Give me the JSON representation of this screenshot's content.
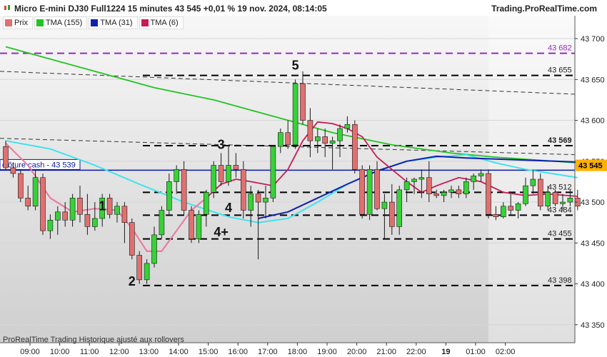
{
  "header": {
    "title": "Micro E-mini DJ30 Full1224 15 minutes 43 545 +0,01 % 19 nov. 2024, 08:14:05",
    "brand": "Trading.ProRealTime.com"
  },
  "legend": [
    {
      "label": "Prix",
      "color": "#e07070"
    },
    {
      "label": "TMA (155)",
      "color": "#22c422"
    },
    {
      "label": "TMA (31)",
      "color": "#1020b0"
    },
    {
      "label": "TMA (6)",
      "color": "#c81a55"
    }
  ],
  "footer": "ProRealTime Trading  Historique ajusté aux rollovers",
  "chart_data": {
    "type": "candlestick",
    "ylim": [
      43328,
      43728
    ],
    "y_ticks": [
      43350,
      43400,
      43450,
      43500,
      43550,
      43600,
      43650,
      43700
    ],
    "y_tick_labels": [
      "43 350",
      "43 400",
      "43 450",
      "43 500",
      "43 550",
      "43 600",
      "43 650",
      "43 700"
    ],
    "x_labels": [
      "09:00",
      "10:00",
      "11:00",
      "12:00",
      "13:00",
      "14:00",
      "15:00",
      "16:00",
      "17:00",
      "18:00",
      "19:00",
      "20:00",
      "21:00",
      "22:00",
      "19",
      "01:00",
      "02:00"
    ],
    "x_label_positions": [
      0,
      4,
      8,
      12,
      16,
      20,
      24,
      28,
      32,
      36,
      40,
      44,
      48,
      52,
      56,
      60,
      64
    ],
    "candles": [
      [
        43568,
        43575,
        43540,
        43542
      ],
      [
        43542,
        43548,
        43530,
        43535
      ],
      [
        43535,
        43540,
        43500,
        43505
      ],
      [
        43505,
        43520,
        43490,
        43495
      ],
      [
        43495,
        43540,
        43490,
        43530
      ],
      [
        43530,
        43535,
        43460,
        43465
      ],
      [
        43465,
        43485,
        43455,
        43478
      ],
      [
        43478,
        43495,
        43460,
        43488
      ],
      [
        43488,
        43500,
        43470,
        43478
      ],
      [
        43478,
        43510,
        43470,
        43505
      ],
      [
        43505,
        43520,
        43475,
        43485
      ],
      [
        43485,
        43510,
        43460,
        43470
      ],
      [
        43470,
        43500,
        43465,
        43480
      ],
      [
        43480,
        43510,
        43470,
        43505
      ],
      [
        43505,
        43510,
        43480,
        43485
      ],
      [
        43485,
        43500,
        43475,
        43495
      ],
      [
        43495,
        43500,
        43450,
        43475
      ],
      [
        43475,
        43480,
        43430,
        43435
      ],
      [
        43435,
        43440,
        43400,
        43405
      ],
      [
        43405,
        43430,
        43400,
        43425
      ],
      [
        43425,
        43470,
        43420,
        43460
      ],
      [
        43460,
        43495,
        43455,
        43490
      ],
      [
        43490,
        43535,
        43485,
        43525
      ],
      [
        43525,
        43545,
        43510,
        43540
      ],
      [
        43540,
        43550,
        43485,
        43490
      ],
      [
        43490,
        43495,
        43450,
        43455
      ],
      [
        43455,
        43490,
        43450,
        43485
      ],
      [
        43485,
        43515,
        43470,
        43512
      ],
      [
        43512,
        43550,
        43505,
        43545
      ],
      [
        43545,
        43560,
        43520,
        43525
      ],
      [
        43525,
        43570,
        43520,
        43545
      ],
      [
        43545,
        43560,
        43530,
        43540
      ],
      [
        43540,
        43550,
        43480,
        43490
      ],
      [
        43490,
        43520,
        43470,
        43510
      ],
      [
        43510,
        43515,
        43430,
        43500
      ],
      [
        43500,
        43520,
        43480,
        43505
      ],
      [
        43505,
        43570,
        43500,
        43568
      ],
      [
        43568,
        43590,
        43560,
        43585
      ],
      [
        43585,
        43600,
        43565,
        43570
      ],
      [
        43570,
        43650,
        43565,
        43645
      ],
      [
        43645,
        43660,
        43595,
        43600
      ],
      [
        43600,
        43615,
        43555,
        43575
      ],
      [
        43575,
        43590,
        43560,
        43580
      ],
      [
        43580,
        43590,
        43555,
        43572
      ],
      [
        43572,
        43580,
        43540,
        43575
      ],
      [
        43575,
        43595,
        43555,
        43590
      ],
      [
        43590,
        43605,
        43585,
        43595
      ],
      [
        43595,
        43600,
        43535,
        43540
      ],
      [
        43540,
        43545,
        43480,
        43485
      ],
      [
        43485,
        43545,
        43478,
        43540
      ],
      [
        43540,
        43550,
        43490,
        43492
      ],
      [
        43492,
        43510,
        43455,
        43500
      ],
      [
        43500,
        43522,
        43460,
        43470
      ],
      [
        43470,
        43520,
        43460,
        43515
      ],
      [
        43515,
        43530,
        43500,
        43525
      ],
      [
        43525,
        43530,
        43510,
        43528
      ],
      [
        43528,
        43540,
        43505,
        43530
      ],
      [
        43530,
        43550,
        43500,
        43510
      ],
      [
        43510,
        43515,
        43505,
        43508
      ],
      [
        43508,
        43515,
        43500,
        43512
      ],
      [
        43512,
        43520,
        43505,
        43515
      ],
      [
        43515,
        43520,
        43505,
        43510
      ],
      [
        43510,
        43530,
        43505,
        43525
      ],
      [
        43525,
        43535,
        43515,
        43532
      ],
      [
        43532,
        43540,
        43525,
        43535
      ],
      [
        43535,
        43540,
        43480,
        43485
      ],
      [
        43485,
        43495,
        43478,
        43482
      ],
      [
        43482,
        43500,
        43480,
        43495
      ],
      [
        43495,
        43510,
        43485,
        43490
      ],
      [
        43490,
        43500,
        43480,
        43498
      ],
      [
        43498,
        43530,
        43495,
        43520
      ],
      [
        43520,
        43540,
        43510,
        43528
      ],
      [
        43528,
        43535,
        43490,
        43495
      ],
      [
        43495,
        43520,
        43490,
        43512
      ],
      [
        43512,
        43515,
        43495,
        43498
      ],
      [
        43498,
        43510,
        43490,
        43500
      ],
      [
        43500,
        43515,
        43495,
        43505
      ],
      [
        43505,
        43515,
        43490,
        43495
      ]
    ],
    "tma_155": [
      [
        0,
        43690
      ],
      [
        6,
        43675
      ],
      [
        12,
        43660
      ],
      [
        20,
        43640
      ],
      [
        28,
        43625
      ],
      [
        36,
        43605
      ],
      [
        44,
        43585
      ],
      [
        52,
        43570
      ],
      [
        60,
        43560
      ],
      [
        66,
        43555
      ],
      [
        77,
        43548
      ]
    ],
    "tma_31": [
      [
        34,
        43480
      ],
      [
        38,
        43488
      ],
      [
        42,
        43505
      ],
      [
        46,
        43522
      ],
      [
        50,
        43538
      ],
      [
        54,
        43550
      ],
      [
        58,
        43556
      ],
      [
        62,
        43554
      ],
      [
        68,
        43552
      ],
      [
        74,
        43550
      ],
      [
        77,
        43549
      ]
    ],
    "tma_6": [
      [
        0,
        43572
      ],
      [
        3,
        43545
      ],
      [
        6,
        43505
      ],
      [
        9,
        43488
      ],
      [
        12,
        43492
      ],
      [
        15,
        43490
      ],
      [
        17,
        43468
      ],
      [
        19,
        43440
      ],
      [
        21,
        43440
      ],
      [
        23,
        43465
      ],
      [
        25,
        43490
      ],
      [
        27,
        43505
      ],
      [
        29,
        43522
      ],
      [
        31,
        43528
      ],
      [
        33,
        43525
      ],
      [
        36,
        43520
      ],
      [
        38,
        43540
      ],
      [
        40,
        43575
      ],
      [
        42,
        43598
      ],
      [
        44,
        43596
      ],
      [
        46,
        43590
      ],
      [
        48,
        43580
      ],
      [
        50,
        43555
      ],
      [
        52,
        43540
      ],
      [
        54,
        43525
      ],
      [
        56,
        43512
      ],
      [
        58,
        43520
      ],
      [
        61,
        43530
      ],
      [
        64,
        43525
      ],
      [
        67,
        43512
      ],
      [
        70,
        43508
      ],
      [
        73,
        43510
      ],
      [
        77,
        43507
      ]
    ],
    "tma_cyan": [
      [
        0,
        43575
      ],
      [
        6,
        43565
      ],
      [
        12,
        43545
      ],
      [
        18,
        43522
      ],
      [
        24,
        43500
      ],
      [
        30,
        43482
      ],
      [
        34,
        43475
      ],
      [
        38,
        43480
      ],
      [
        42,
        43500
      ],
      [
        46,
        43522
      ],
      [
        50,
        43538
      ],
      [
        54,
        43550
      ],
      [
        58,
        43555
      ],
      [
        62,
        43558
      ],
      [
        66,
        43548
      ],
      [
        70,
        43540
      ],
      [
        77,
        43530
      ]
    ],
    "h_lines_dashed": [
      43682,
      43655,
      43569,
      43512,
      43484,
      43455,
      43398
    ],
    "h_line_labels": [
      "43 682",
      "43 655",
      "43 569",
      "43 512",
      "43 484",
      "43 455",
      "43 398"
    ],
    "cash_close_label": "clôture cash -  43 539",
    "cash_close_value": 43539,
    "last_price_label": "43 545",
    "last_price": 43545,
    "wave_labels": [
      {
        "text": "5",
        "i": 39,
        "v": 43662
      },
      {
        "text": "3",
        "i": 29,
        "v": 43565
      },
      {
        "text": "1",
        "i": 13,
        "v": 43490
      },
      {
        "text": "2",
        "i": 17,
        "v": 43398
      },
      {
        "text": "4",
        "i": 30,
        "v": 43488
      },
      {
        "text": "4+",
        "i": 29,
        "v": 43458
      }
    ]
  }
}
